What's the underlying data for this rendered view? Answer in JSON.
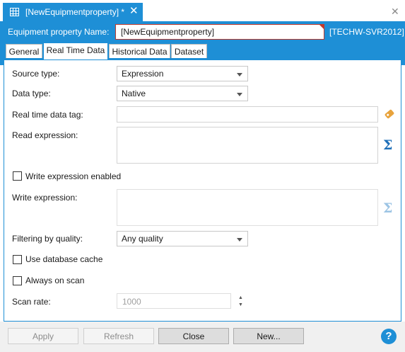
{
  "document_tab": {
    "title": "[NewEquipmentproperty] *",
    "close_glyph": "✕"
  },
  "window": {
    "close_glyph": "✕"
  },
  "header": {
    "name_label": "Equipment property Name:",
    "name_value": "[NewEquipmentproperty]",
    "server": "[TECHW-SVR2012]"
  },
  "tabs": [
    {
      "label": "General",
      "active": false
    },
    {
      "label": "Real Time Data",
      "active": true
    },
    {
      "label": "Historical Data",
      "active": false
    },
    {
      "label": "Dataset",
      "active": false
    }
  ],
  "form": {
    "source_type": {
      "label": "Source type:",
      "value": "Expression"
    },
    "data_type": {
      "label": "Data type:",
      "value": "Native"
    },
    "real_time_tag": {
      "label": "Real time data tag:",
      "value": ""
    },
    "read_expression": {
      "label": "Read expression:",
      "value": ""
    },
    "write_enabled": {
      "label": "Write expression enabled",
      "checked": false
    },
    "write_expression": {
      "label": "Write expression:",
      "value": ""
    },
    "filtering": {
      "label": "Filtering by quality:",
      "value": "Any quality"
    },
    "use_cache": {
      "label": "Use database cache",
      "checked": false
    },
    "always_on_scan": {
      "label": "Always on scan",
      "checked": false
    },
    "scan_rate": {
      "label": "Scan rate:",
      "value": "1000"
    },
    "sigma_glyph": "Σ",
    "spin_up": "▲",
    "spin_down": "▼"
  },
  "footer": {
    "apply": "Apply",
    "refresh": "Refresh",
    "close": "Close",
    "new": "New...",
    "help": "?"
  },
  "colors": {
    "accent": "#1e8fd6",
    "sigma_enabled": "#1e6fb8",
    "sigma_disabled": "#9cc4e4",
    "tag_icon": "#e8a33c",
    "error_border": "#c0392b"
  },
  "icons": [
    "grid-icon",
    "close-icon",
    "dropdown-arrow-icon",
    "tag-browse-icon",
    "sigma-icon",
    "spin-up-icon",
    "spin-down-icon",
    "help-icon"
  ]
}
